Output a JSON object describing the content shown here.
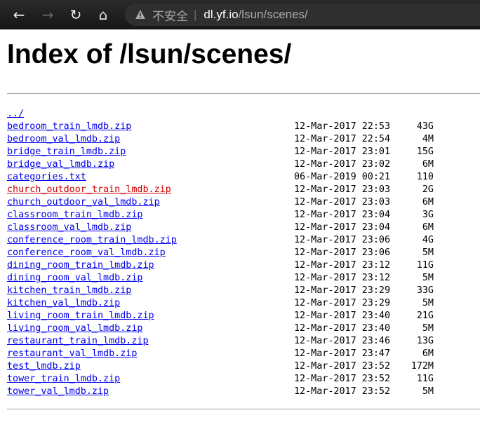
{
  "browser": {
    "url_warning": "不安全",
    "url_separator": "|",
    "url_host": "dl.yf.io",
    "url_path": "/lsun/scenes/",
    "icons": {
      "back": "back-arrow-icon",
      "forward": "forward-arrow-icon",
      "reload": "reload-icon",
      "home": "home-icon",
      "warning": "warning-triangle-icon"
    },
    "glyphs": {
      "back": "←",
      "forward": "→",
      "reload": "↻",
      "home": "⌂"
    }
  },
  "page": {
    "title": "Index of /lsun/scenes/",
    "parent_link": "../",
    "files": [
      {
        "name": "bedroom_train_lmdb.zip",
        "date": "12-Mar-2017 22:53",
        "size": "43G"
      },
      {
        "name": "bedroom_val_lmdb.zip",
        "date": "12-Mar-2017 22:54",
        "size": "4M"
      },
      {
        "name": "bridge_train_lmdb.zip",
        "date": "12-Mar-2017 23:01",
        "size": "15G"
      },
      {
        "name": "bridge_val_lmdb.zip",
        "date": "12-Mar-2017 23:02",
        "size": "6M"
      },
      {
        "name": "categories.txt",
        "date": "06-Mar-2019 00:21",
        "size": "110"
      },
      {
        "name": "church_outdoor_train_lmdb.zip",
        "date": "12-Mar-2017 23:03",
        "size": "2G",
        "visited": true
      },
      {
        "name": "church_outdoor_val_lmdb.zip",
        "date": "12-Mar-2017 23:03",
        "size": "6M"
      },
      {
        "name": "classroom_train_lmdb.zip",
        "date": "12-Mar-2017 23:04",
        "size": "3G"
      },
      {
        "name": "classroom_val_lmdb.zip",
        "date": "12-Mar-2017 23:04",
        "size": "6M"
      },
      {
        "name": "conference_room_train_lmdb.zip",
        "date": "12-Mar-2017 23:06",
        "size": "4G"
      },
      {
        "name": "conference_room_val_lmdb.zip",
        "date": "12-Mar-2017 23:06",
        "size": "5M"
      },
      {
        "name": "dining_room_train_lmdb.zip",
        "date": "12-Mar-2017 23:12",
        "size": "11G"
      },
      {
        "name": "dining_room_val_lmdb.zip",
        "date": "12-Mar-2017 23:12",
        "size": "5M"
      },
      {
        "name": "kitchen_train_lmdb.zip",
        "date": "12-Mar-2017 23:29",
        "size": "33G"
      },
      {
        "name": "kitchen_val_lmdb.zip",
        "date": "12-Mar-2017 23:29",
        "size": "5M"
      },
      {
        "name": "living_room_train_lmdb.zip",
        "date": "12-Mar-2017 23:40",
        "size": "21G"
      },
      {
        "name": "living_room_val_lmdb.zip",
        "date": "12-Mar-2017 23:40",
        "size": "5M"
      },
      {
        "name": "restaurant_train_lmdb.zip",
        "date": "12-Mar-2017 23:46",
        "size": "13G"
      },
      {
        "name": "restaurant_val_lmdb.zip",
        "date": "12-Mar-2017 23:47",
        "size": "6M"
      },
      {
        "name": "test_lmdb.zip",
        "date": "12-Mar-2017 23:52",
        "size": "172M"
      },
      {
        "name": "tower_train_lmdb.zip",
        "date": "12-Mar-2017 23:52",
        "size": "11G"
      },
      {
        "name": "tower_val_lmdb.zip",
        "date": "12-Mar-2017 23:52",
        "size": "5M"
      }
    ]
  },
  "colors": {
    "link": "#0000ee",
    "visited_link": "#cc0000",
    "toolbar": "#1f1f1f",
    "rule": "#a0a0a0"
  }
}
